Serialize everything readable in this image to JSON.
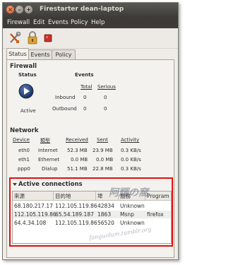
{
  "window": {
    "title": "Firestarter dean-laptop"
  },
  "menu": [
    "Firewall",
    "Edit",
    "Events",
    "Policy",
    "Help"
  ],
  "tabs": [
    "Status",
    "Events",
    "Policy"
  ],
  "firewall": {
    "section_title": "Firewall",
    "status_header": "Status",
    "status_value": "Active",
    "events_header": "Events",
    "col_total": "Total",
    "col_serious": "Serious",
    "inbound_label": "Inbound",
    "inbound_total": "0",
    "inbound_serious": "0",
    "outbound_label": "Outbound",
    "outbound_total": "0",
    "outbound_serious": "0"
  },
  "network": {
    "section_title": "Network",
    "headers": [
      "Device",
      "類型",
      "Received",
      "Sent",
      "Activity"
    ],
    "rows": [
      [
        "eth0",
        "Internet",
        "52.3 MB",
        "23.9 MB",
        "0.3 KB/s"
      ],
      [
        "eth1",
        "Ethernet",
        "0.0 MB",
        "0.0 MB",
        "0.0 KB/s"
      ],
      [
        "ppp0",
        "Dialup",
        "51.1 MB",
        "22.8 MB",
        "0.3 KB/s"
      ]
    ]
  },
  "connections": {
    "section_title": "Active connections",
    "headers": [
      "來源",
      "目的地",
      "埠",
      "服務",
      "Program"
    ],
    "rows": [
      [
        "68.180.217.17",
        "112.105.119.86",
        "42834",
        "Unknown",
        ""
      ],
      [
        "112.105.119.86",
        "65.54.189.187",
        "1863",
        "Msnp",
        "firefox"
      ],
      [
        "64.4.34.108",
        "112.105.119.86",
        "56520",
        "Unknown",
        ""
      ]
    ]
  },
  "watermark": {
    "line1": "阿輝の窩",
    "line2": "fanguolum.tumblr.org"
  },
  "colors": {
    "highlight_box": "#e01010",
    "titlebar": "#3c3b37"
  }
}
